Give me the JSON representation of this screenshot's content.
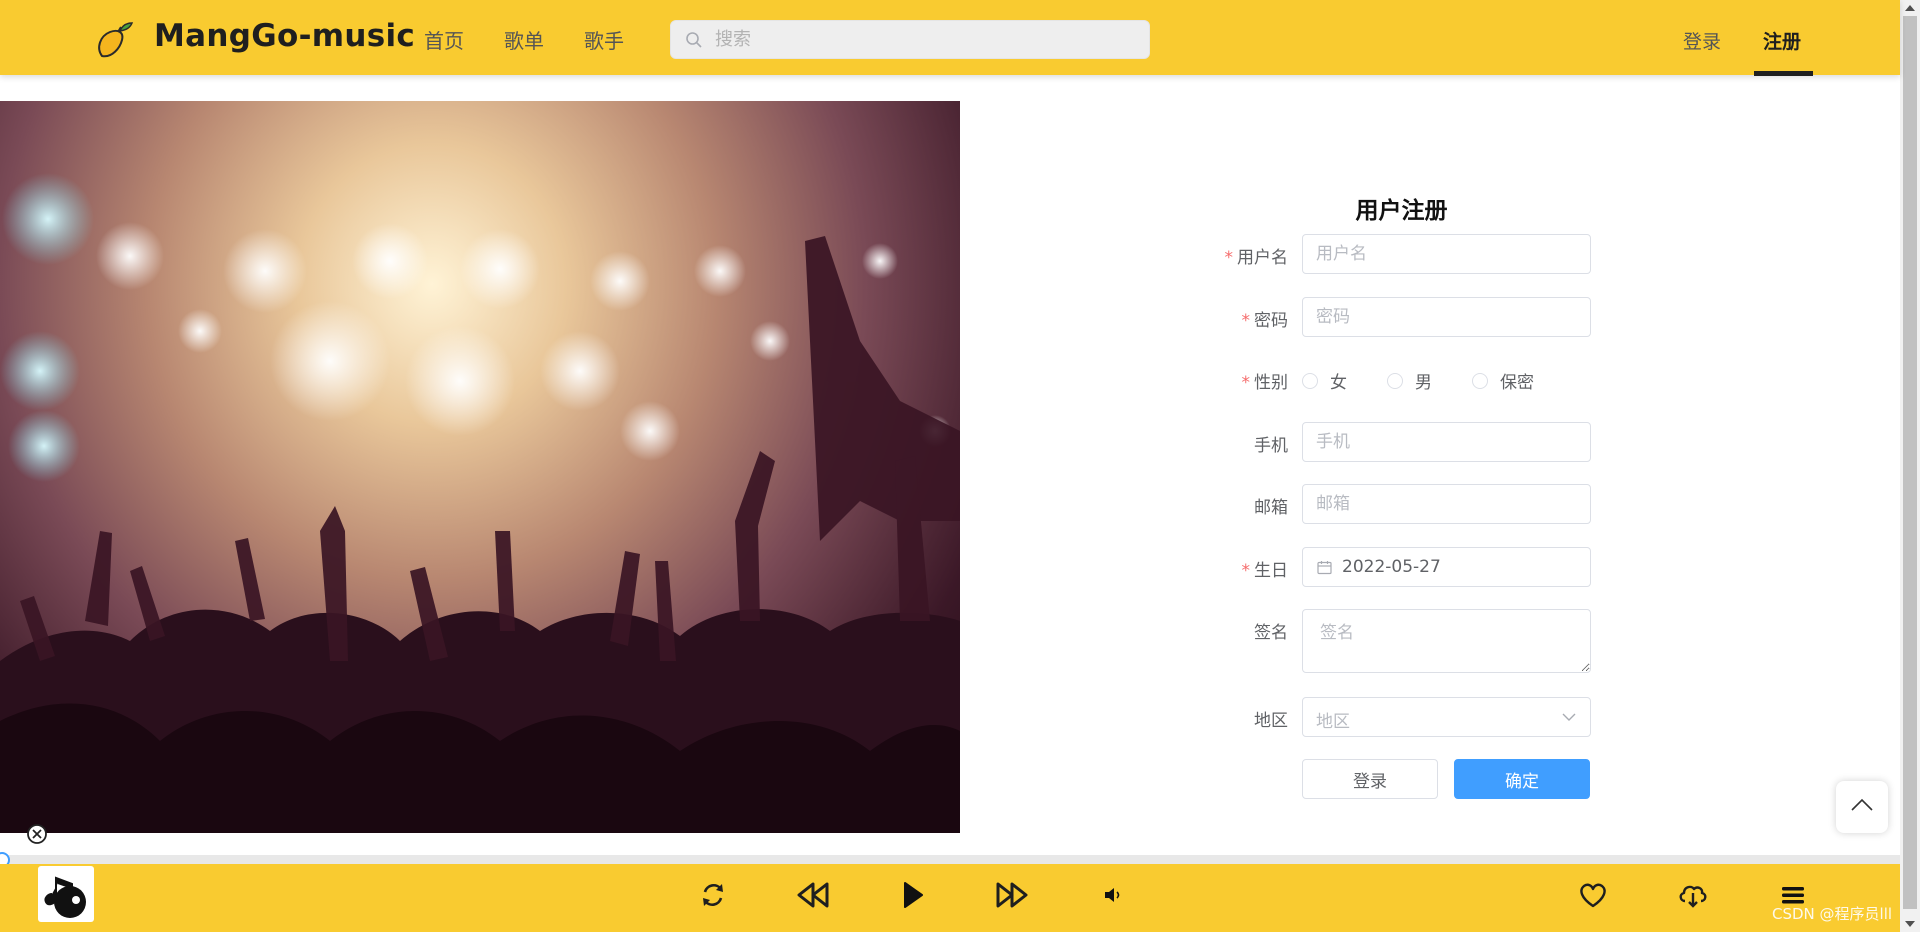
{
  "header": {
    "brand": "MangGo-music",
    "nav": [
      "首页",
      "歌单",
      "歌手"
    ],
    "search_placeholder": "搜索",
    "login": "登录",
    "register": "注册"
  },
  "form": {
    "title": "用户注册",
    "username": {
      "label": "用户名",
      "placeholder": "用户名"
    },
    "password": {
      "label": "密码",
      "placeholder": "密码"
    },
    "gender": {
      "label": "性别",
      "options": [
        "女",
        "男",
        "保密"
      ]
    },
    "phone": {
      "label": "手机",
      "placeholder": "手机"
    },
    "email": {
      "label": "邮箱",
      "placeholder": "邮箱"
    },
    "birthday": {
      "label": "生日",
      "value": "2022-05-27"
    },
    "signature": {
      "label": "签名",
      "placeholder": "签名"
    },
    "region": {
      "label": "地区",
      "placeholder": "地区"
    },
    "login_button": "登录",
    "confirm_button": "确定",
    "required_mark": "*"
  },
  "footer": {
    "watermark": "CSDN @程序员lll"
  },
  "colors": {
    "header_bg": "#f9cb30",
    "primary": "#409eff",
    "required": "#f56c6c"
  },
  "icons": [
    "mango-logo-icon",
    "search-icon",
    "calendar-icon",
    "chevron-down-icon",
    "arrow-up-icon",
    "close-circle-icon",
    "repeat-icon",
    "previous-icon",
    "play-icon",
    "next-icon",
    "volume-icon",
    "heart-icon",
    "cloud-download-icon",
    "playlist-menu-icon"
  ]
}
